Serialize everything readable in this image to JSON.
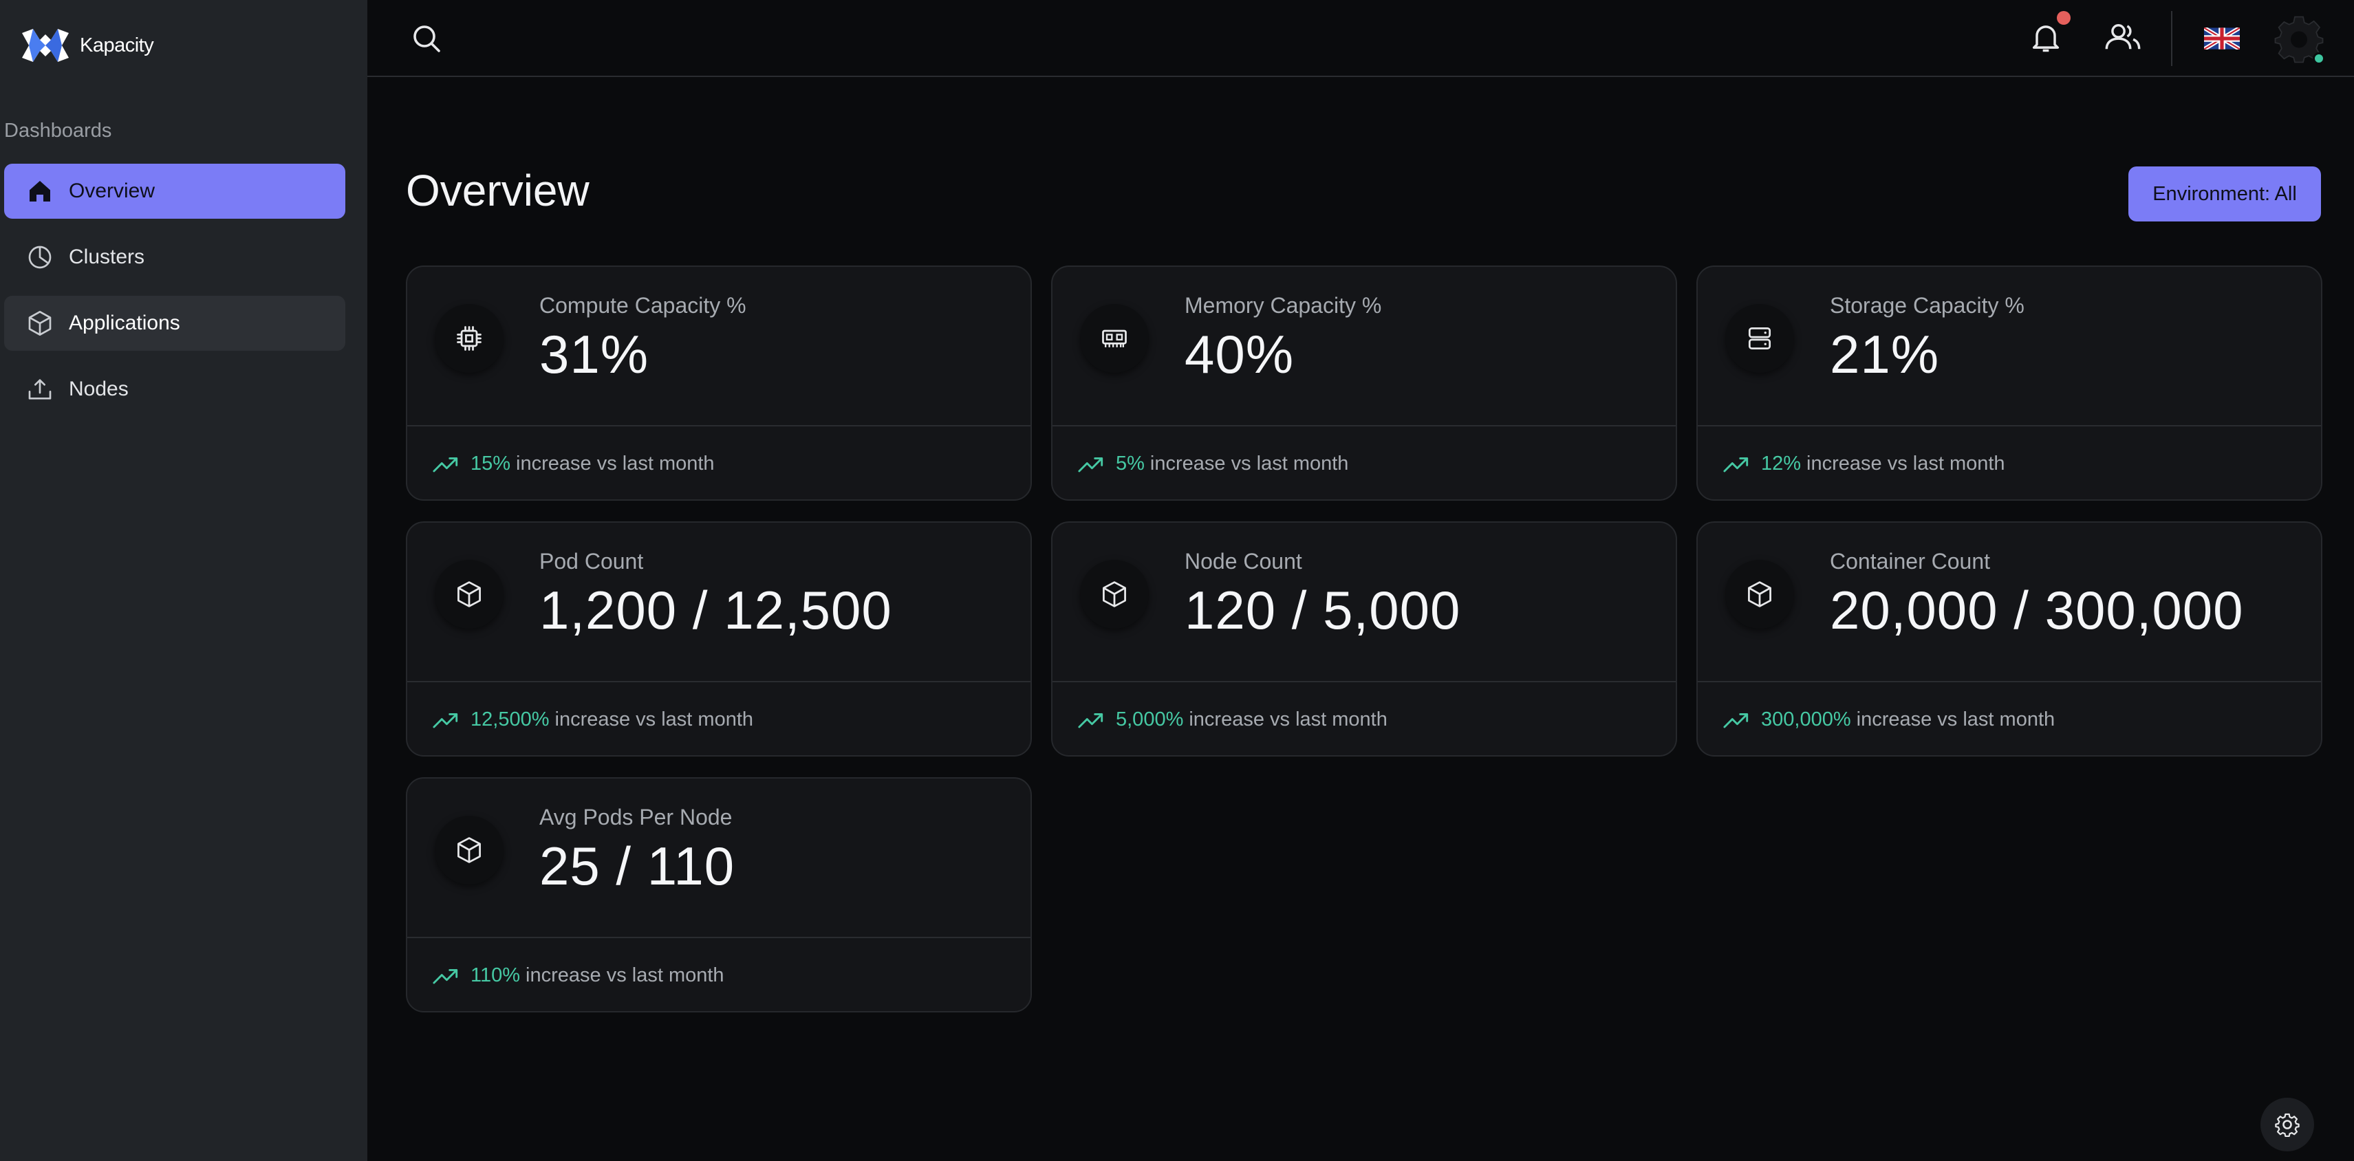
{
  "brand": {
    "name": "Kapacity"
  },
  "sidebar": {
    "section_label": "Dashboards",
    "items": [
      {
        "label": "Overview",
        "icon": "home-icon",
        "state": "active"
      },
      {
        "label": "Clusters",
        "icon": "pie-chart-icon",
        "state": "normal"
      },
      {
        "label": "Applications",
        "icon": "cube-icon",
        "state": "hover"
      },
      {
        "label": "Nodes",
        "icon": "upload-icon",
        "state": "normal"
      }
    ]
  },
  "topbar": {
    "icons": [
      "search-icon",
      "bell-icon",
      "users-icon",
      "uk-flag-icon",
      "settings-gear-icon"
    ],
    "notification_dot_color": "#e5605c",
    "status_color": "#3ec6a0"
  },
  "main": {
    "title": "Overview",
    "environment_button": "Environment: All",
    "footer_suffix": "increase vs last month",
    "cards": [
      {
        "label": "Compute Capacity %",
        "value": "31%",
        "change": "15%",
        "icon": "cpu-chip-icon"
      },
      {
        "label": "Memory Capacity %",
        "value": "40%",
        "change": "5%",
        "icon": "memory-icon"
      },
      {
        "label": "Storage Capacity %",
        "value": "21%",
        "change": "12%",
        "icon": "server-storage-icon"
      },
      {
        "label": "Pod Count",
        "value": "1,200 / 12,500",
        "change": "12,500%",
        "icon": "cube-icon"
      },
      {
        "label": "Node Count",
        "value": "120 / 5,000",
        "change": "5,000%",
        "icon": "cube-icon"
      },
      {
        "label": "Container Count",
        "value": "20,000 / 300,000",
        "change": "300,000%",
        "icon": "cube-icon"
      },
      {
        "label": "Avg Pods Per Node",
        "value": "25 / 110",
        "change": "110%",
        "icon": "cube-icon"
      }
    ]
  },
  "colors": {
    "accent": "#7b7cf6",
    "positive": "#46c9a4",
    "sidebar_bg": "#212428",
    "page_bg": "#0a0b0d",
    "card_bg": "#141518"
  }
}
